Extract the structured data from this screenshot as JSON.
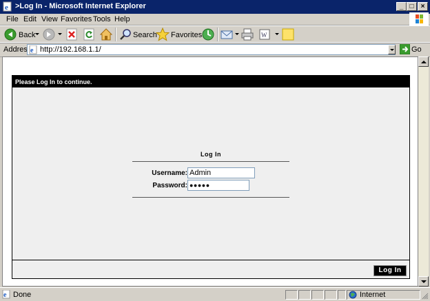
{
  "window": {
    "title": ">Log In - Microsoft Internet Explorer"
  },
  "menu": [
    {
      "label": "File",
      "key": "F"
    },
    {
      "label": "Edit",
      "key": "E"
    },
    {
      "label": "View",
      "key": "V"
    },
    {
      "label": "Favorites",
      "key": "a"
    },
    {
      "label": "Tools",
      "key": "T"
    },
    {
      "label": "Help",
      "key": "H"
    }
  ],
  "toolbar": {
    "back_label": "Back",
    "search_label": "Search",
    "favorites_label": "Favorites"
  },
  "address": {
    "label": "Address",
    "url": "http://192.168.1.1/",
    "go_label": "Go"
  },
  "page": {
    "header": "Please Log In to continue.",
    "heading": "Log In",
    "username_label": "Username:",
    "username_value": "Admin",
    "password_label": "Password:",
    "password_value": "●●●●●",
    "login_button": "Log In"
  },
  "status": {
    "left": "Done",
    "zone": "Internet"
  },
  "colors": {
    "titlebar": "#0a246a",
    "chrome": "#d4d0c8",
    "page_bg": "#efefef",
    "header_bg": "#000000"
  }
}
